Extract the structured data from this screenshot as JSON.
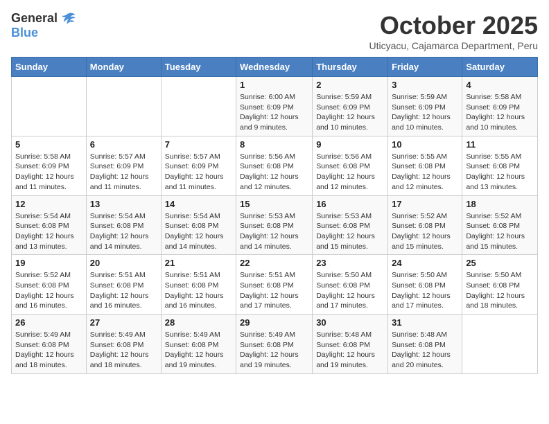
{
  "header": {
    "logo_line1": "General",
    "logo_line2": "Blue",
    "month_title": "October 2025",
    "location": "Uticyacu, Cajamarca Department, Peru"
  },
  "weekdays": [
    "Sunday",
    "Monday",
    "Tuesday",
    "Wednesday",
    "Thursday",
    "Friday",
    "Saturday"
  ],
  "weeks": [
    [
      {
        "day": "",
        "info": ""
      },
      {
        "day": "",
        "info": ""
      },
      {
        "day": "",
        "info": ""
      },
      {
        "day": "1",
        "info": "Sunrise: 6:00 AM\nSunset: 6:09 PM\nDaylight: 12 hours\nand 9 minutes."
      },
      {
        "day": "2",
        "info": "Sunrise: 5:59 AM\nSunset: 6:09 PM\nDaylight: 12 hours\nand 10 minutes."
      },
      {
        "day": "3",
        "info": "Sunrise: 5:59 AM\nSunset: 6:09 PM\nDaylight: 12 hours\nand 10 minutes."
      },
      {
        "day": "4",
        "info": "Sunrise: 5:58 AM\nSunset: 6:09 PM\nDaylight: 12 hours\nand 10 minutes."
      }
    ],
    [
      {
        "day": "5",
        "info": "Sunrise: 5:58 AM\nSunset: 6:09 PM\nDaylight: 12 hours\nand 11 minutes."
      },
      {
        "day": "6",
        "info": "Sunrise: 5:57 AM\nSunset: 6:09 PM\nDaylight: 12 hours\nand 11 minutes."
      },
      {
        "day": "7",
        "info": "Sunrise: 5:57 AM\nSunset: 6:09 PM\nDaylight: 12 hours\nand 11 minutes."
      },
      {
        "day": "8",
        "info": "Sunrise: 5:56 AM\nSunset: 6:08 PM\nDaylight: 12 hours\nand 12 minutes."
      },
      {
        "day": "9",
        "info": "Sunrise: 5:56 AM\nSunset: 6:08 PM\nDaylight: 12 hours\nand 12 minutes."
      },
      {
        "day": "10",
        "info": "Sunrise: 5:55 AM\nSunset: 6:08 PM\nDaylight: 12 hours\nand 12 minutes."
      },
      {
        "day": "11",
        "info": "Sunrise: 5:55 AM\nSunset: 6:08 PM\nDaylight: 12 hours\nand 13 minutes."
      }
    ],
    [
      {
        "day": "12",
        "info": "Sunrise: 5:54 AM\nSunset: 6:08 PM\nDaylight: 12 hours\nand 13 minutes."
      },
      {
        "day": "13",
        "info": "Sunrise: 5:54 AM\nSunset: 6:08 PM\nDaylight: 12 hours\nand 14 minutes."
      },
      {
        "day": "14",
        "info": "Sunrise: 5:54 AM\nSunset: 6:08 PM\nDaylight: 12 hours\nand 14 minutes."
      },
      {
        "day": "15",
        "info": "Sunrise: 5:53 AM\nSunset: 6:08 PM\nDaylight: 12 hours\nand 14 minutes."
      },
      {
        "day": "16",
        "info": "Sunrise: 5:53 AM\nSunset: 6:08 PM\nDaylight: 12 hours\nand 15 minutes."
      },
      {
        "day": "17",
        "info": "Sunrise: 5:52 AM\nSunset: 6:08 PM\nDaylight: 12 hours\nand 15 minutes."
      },
      {
        "day": "18",
        "info": "Sunrise: 5:52 AM\nSunset: 6:08 PM\nDaylight: 12 hours\nand 15 minutes."
      }
    ],
    [
      {
        "day": "19",
        "info": "Sunrise: 5:52 AM\nSunset: 6:08 PM\nDaylight: 12 hours\nand 16 minutes."
      },
      {
        "day": "20",
        "info": "Sunrise: 5:51 AM\nSunset: 6:08 PM\nDaylight: 12 hours\nand 16 minutes."
      },
      {
        "day": "21",
        "info": "Sunrise: 5:51 AM\nSunset: 6:08 PM\nDaylight: 12 hours\nand 16 minutes."
      },
      {
        "day": "22",
        "info": "Sunrise: 5:51 AM\nSunset: 6:08 PM\nDaylight: 12 hours\nand 17 minutes."
      },
      {
        "day": "23",
        "info": "Sunrise: 5:50 AM\nSunset: 6:08 PM\nDaylight: 12 hours\nand 17 minutes."
      },
      {
        "day": "24",
        "info": "Sunrise: 5:50 AM\nSunset: 6:08 PM\nDaylight: 12 hours\nand 17 minutes."
      },
      {
        "day": "25",
        "info": "Sunrise: 5:50 AM\nSunset: 6:08 PM\nDaylight: 12 hours\nand 18 minutes."
      }
    ],
    [
      {
        "day": "26",
        "info": "Sunrise: 5:49 AM\nSunset: 6:08 PM\nDaylight: 12 hours\nand 18 minutes."
      },
      {
        "day": "27",
        "info": "Sunrise: 5:49 AM\nSunset: 6:08 PM\nDaylight: 12 hours\nand 18 minutes."
      },
      {
        "day": "28",
        "info": "Sunrise: 5:49 AM\nSunset: 6:08 PM\nDaylight: 12 hours\nand 19 minutes."
      },
      {
        "day": "29",
        "info": "Sunrise: 5:49 AM\nSunset: 6:08 PM\nDaylight: 12 hours\nand 19 minutes."
      },
      {
        "day": "30",
        "info": "Sunrise: 5:48 AM\nSunset: 6:08 PM\nDaylight: 12 hours\nand 19 minutes."
      },
      {
        "day": "31",
        "info": "Sunrise: 5:48 AM\nSunset: 6:08 PM\nDaylight: 12 hours\nand 20 minutes."
      },
      {
        "day": "",
        "info": ""
      }
    ]
  ]
}
